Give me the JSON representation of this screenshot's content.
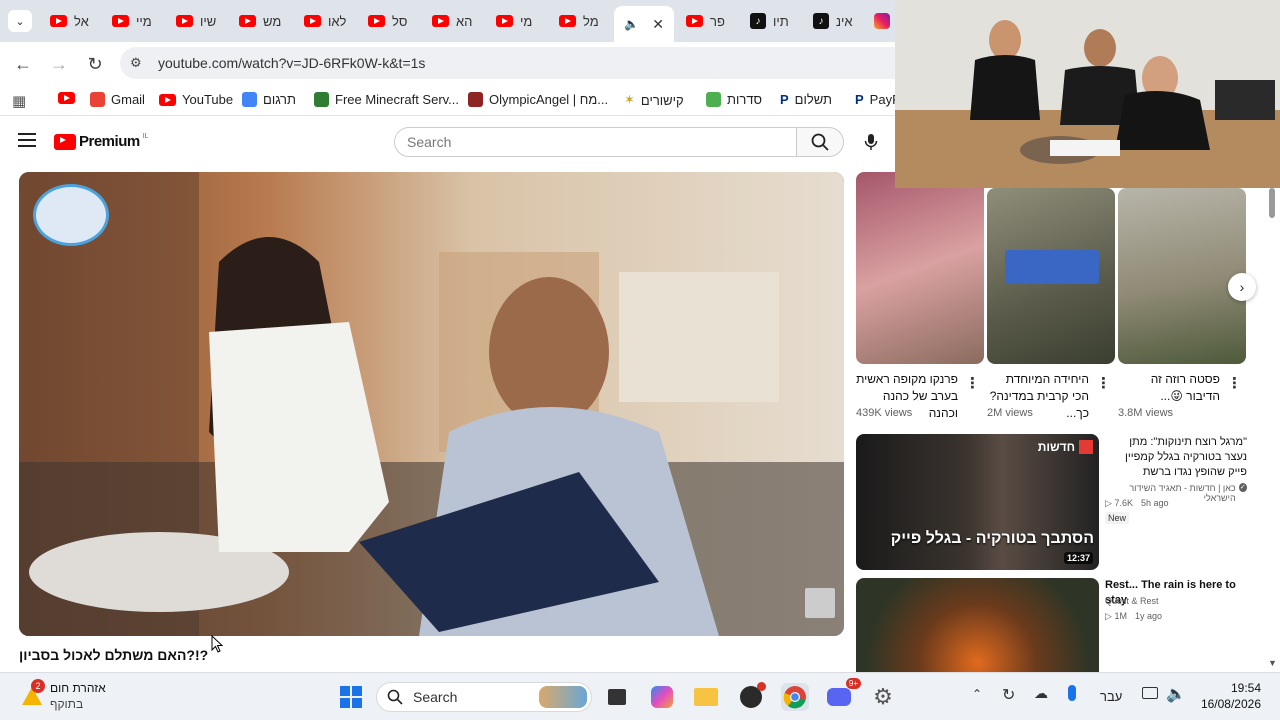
{
  "tabs": [
    {
      "label": "אל",
      "icon": "youtube-icon"
    },
    {
      "label": "מיי",
      "icon": "youtube-icon"
    },
    {
      "label": "שיו",
      "icon": "youtube-icon"
    },
    {
      "label": "מש",
      "icon": "youtube-icon"
    },
    {
      "label": "לאו",
      "icon": "youtube-icon"
    },
    {
      "label": "סל",
      "icon": "youtube-icon"
    },
    {
      "label": "הא",
      "icon": "youtube-icon"
    },
    {
      "label": "מי",
      "icon": "youtube-icon"
    },
    {
      "label": "מל",
      "icon": "youtube-icon"
    },
    {
      "label": "פר",
      "icon": "youtube-icon"
    },
    {
      "label": "תיו",
      "icon": "tiktok-icon"
    },
    {
      "label": "אינ",
      "icon": "tiktok-icon"
    }
  ],
  "address": {
    "url": "youtube.com/watch?v=JD-6RFk0W-k&t=1s"
  },
  "bookmarks": [
    {
      "label": "Gmail",
      "color": "#ea4335"
    },
    {
      "label": "YouTube",
      "color": "#ff0000"
    },
    {
      "label": "תרגום",
      "color": "#4285f4"
    },
    {
      "label": "Free Minecraft Serv...",
      "color": "#2e7d32"
    },
    {
      "label": "OlympicAngel | מח...",
      "color": "#8e2424"
    },
    {
      "label": "קישורים",
      "color": "#f9c74f"
    },
    {
      "label": "סדרות",
      "color": "#4caf50"
    },
    {
      "label": "תשלום",
      "color": "#003087"
    },
    {
      "label": "PayP",
      "color": "#003087"
    }
  ],
  "youtube": {
    "logo": "Premium",
    "country": "IL",
    "search_placeholder": "Search"
  },
  "video": {
    "title": "האם משתלם לאכול בסביון?!?"
  },
  "shorts": [
    {
      "title": "פרנקו מקופה ראשית בערב של כהנה וכהנה",
      "views": "439K views"
    },
    {
      "title": "היחידה המיוחדת הכי קרבית במדינה? כך...",
      "views": "2M views"
    },
    {
      "title": "פסטה רוזה זה הדיבור 😜...",
      "views": "3.8M views"
    }
  ],
  "recommended": [
    {
      "title": "\"מרגל רוצח תינוקות\": מתן נעצר בטורקיה בגלל קמפיין פייק שהופץ נגדו ברשת",
      "channel": "כאן | חדשות - תאגיד השידור הישראלי",
      "views": "7.6K",
      "age": "5h ago",
      "badge": "New",
      "duration": "12:37",
      "thumb_caption": "הסתבך בטורקיה - בגלל פייק",
      "thumb_tag": "חדשות"
    },
    {
      "title": "Rest... The rain is here to stay",
      "channel": "Quest & Rest",
      "views": "1M",
      "age": "1y ago"
    }
  ],
  "taskbar": {
    "weather_title": "אזהרת חום",
    "weather_sub": "בתוקף",
    "weather_badge": "2",
    "search_label": "Search",
    "language": "עבר",
    "time": "19:54",
    "date": "16/08/2026",
    "discord_badge": "9+"
  }
}
